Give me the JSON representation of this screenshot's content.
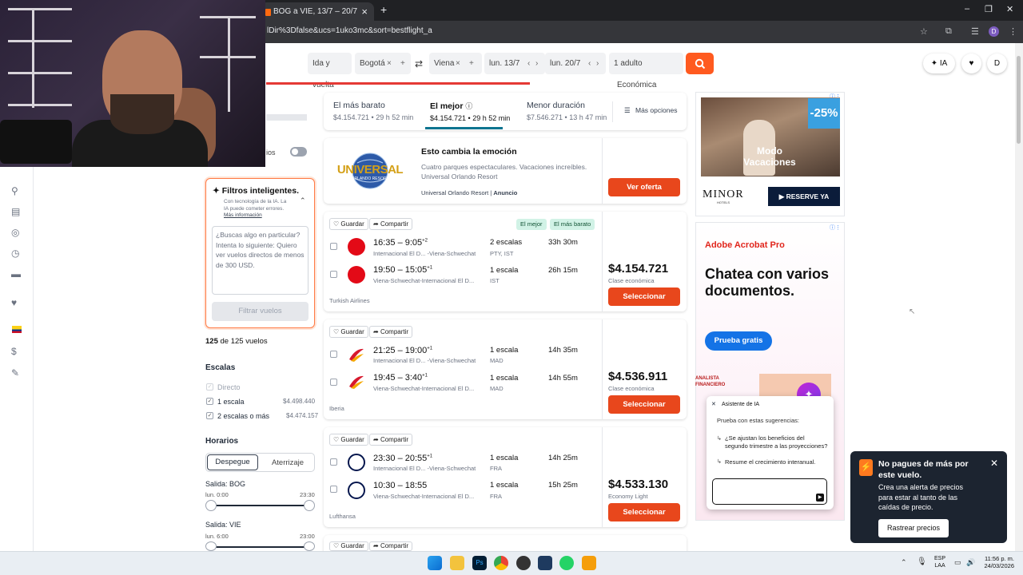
{
  "browser": {
    "tab_title": "BOG a VIE, 13/7 – 20/7",
    "url": "lDir%3Dfalse&ucs=1uko3mc&sort=bestflight_a",
    "profile_initial": "D"
  },
  "search": {
    "trip_type": "Ida y vuelta",
    "origin": "Bogotá",
    "destination": "Viena",
    "depart_date": "lun. 13/7",
    "return_date": "lun. 20/7",
    "passengers": "1 adulto",
    "cabin": "Económica",
    "ai_button": "IA",
    "user_initial": "D"
  },
  "filters": {
    "direct_label_partial": "ios",
    "smart_title": "Filtros inteligentes.",
    "smart_note": "Con tecnología de la IA. La IA puede cometer errores.",
    "smart_link": "Más información",
    "prompt_placeholder": "¿Buscas algo en particular? Intenta lo siguiente: Quiero ver vuelos directos de menos de 300 USD.",
    "filter_button": "Filtrar vuelos",
    "count_bold": "125",
    "count_rest": "de 125 vuelos",
    "stops_title": "Escalas",
    "stops": [
      {
        "label": "Directo",
        "price": "",
        "checked": true,
        "disabled": true
      },
      {
        "label": "1 escala",
        "price": "$4.498.440",
        "checked": true,
        "disabled": false
      },
      {
        "label": "2 escalas o más",
        "price": "$4.474.157",
        "checked": true,
        "disabled": false
      }
    ],
    "times_title": "Horarios",
    "time_tabs": [
      "Despegue",
      "Aterrizaje"
    ],
    "out_label": "Salida: BOG",
    "out_from": "lun. 0:00",
    "out_to": "23:30",
    "ret_label": "Salida: VIE",
    "ret_from": "lun. 6:00",
    "ret_to": "23:00"
  },
  "sort": {
    "tabs": [
      {
        "title": "El más barato",
        "sub": "$4.154.721 • 29 h 52 min"
      },
      {
        "title": "El mejor",
        "sub": "$4.154.721 • 29 h 52 min"
      },
      {
        "title": "Menor duración",
        "sub": "$7.546.271 • 13 h 47 min"
      }
    ],
    "more": "Más opciones"
  },
  "promo": {
    "logo_text": "UNIVERSAL",
    "logo_sub": "ORLANDO RESORT",
    "title": "Esto cambia la emoción",
    "desc": "Cuatro parques espectaculares. Vacaciones increíbles. Universal Orlando Resort",
    "advertiser": "Universal Orlando Resort",
    "ad_label": "Anuncio",
    "cta": "Ver oferta"
  },
  "actions": {
    "save": "Guardar",
    "share": "Compartir",
    "select": "Seleccionar"
  },
  "flights": [
    {
      "badges": [
        "El mejor",
        "El más barato"
      ],
      "airline": "Turkish Airlines",
      "logo_color": "#e30a17",
      "legs": [
        {
          "times": "16:35 – 9:05",
          "sup": "+2",
          "route": "Internacional El D... -Viena-Schwechat",
          "stops": "2 escalas",
          "via": "PTY, IST",
          "duration": "33h 30m"
        },
        {
          "times": "19:50 – 15:05",
          "sup": "+1",
          "route": "Viena-Schwechat-Internacional El D...",
          "stops": "1 escala",
          "via": "IST",
          "duration": "26h 15m"
        }
      ],
      "price": "$4.154.721",
      "cabin": "Clase económica"
    },
    {
      "badges": [],
      "airline": "Iberia",
      "logo_color": "#d7192d",
      "legs": [
        {
          "times": "21:25 – 19:00",
          "sup": "+1",
          "route": "Internacional El D... -Viena-Schwechat",
          "stops": "1 escala",
          "via": "MAD",
          "duration": "14h 35m"
        },
        {
          "times": "19:45 – 3:40",
          "sup": "+1",
          "route": "Viena-Schwechat-Internacional El D...",
          "stops": "1 escala",
          "via": "MAD",
          "duration": "14h 55m"
        }
      ],
      "price": "$4.536.911",
      "cabin": "Clase económica"
    },
    {
      "badges": [],
      "airline": "Lufthansa",
      "logo_color": "#05164d",
      "legs": [
        {
          "times": "23:30 – 20:55",
          "sup": "+1",
          "route": "Internacional El D... -Viena-Schwechat",
          "stops": "1 escala",
          "via": "FRA",
          "duration": "14h 25m"
        },
        {
          "times": "10:30 – 18:55",
          "sup": "",
          "route": "Viena-Schwechat-Internacional El D...",
          "stops": "1 escala",
          "via": "FRA",
          "duration": "15h 25m"
        }
      ],
      "price": "$4.533.130",
      "cabin": "Economy Light"
    }
  ],
  "ads": {
    "minor_discount": "-25%",
    "minor_headline": "Modo Vacaciones",
    "minor_brand": "MINOR",
    "minor_brand_sub": "HOTELS",
    "minor_cta": "RESERVE YA",
    "acrobat_brand": "Adobe Acrobat Pro",
    "acrobat_headline": "Chatea con varios documentos.",
    "acrobat_cta": "Prueba gratis",
    "acrobat_doc": "ANALISTA FINANCIERO"
  },
  "assistant": {
    "title": "Asistente de IA",
    "prompt": "Prueba con estas sugerencias:",
    "s1": "¿Se ajustan los beneficios del segundo trimestre a las proyecciones?",
    "s2": "Resume el crecimiento interanual."
  },
  "toast": {
    "title": "No pagues de más por este vuelo.",
    "body": "Crea una alerta de precios para estar al tanto de las caídas de precio.",
    "button": "Rastrear precios"
  },
  "taskbar": {
    "lang1": "ESP",
    "lang2": "LAA",
    "time": "11:56 p. m.",
    "date": "24/03/2026"
  },
  "colors": {
    "accent": "#ff5a1f",
    "cta": "#e8471c",
    "toast_bg": "#1c2430"
  }
}
